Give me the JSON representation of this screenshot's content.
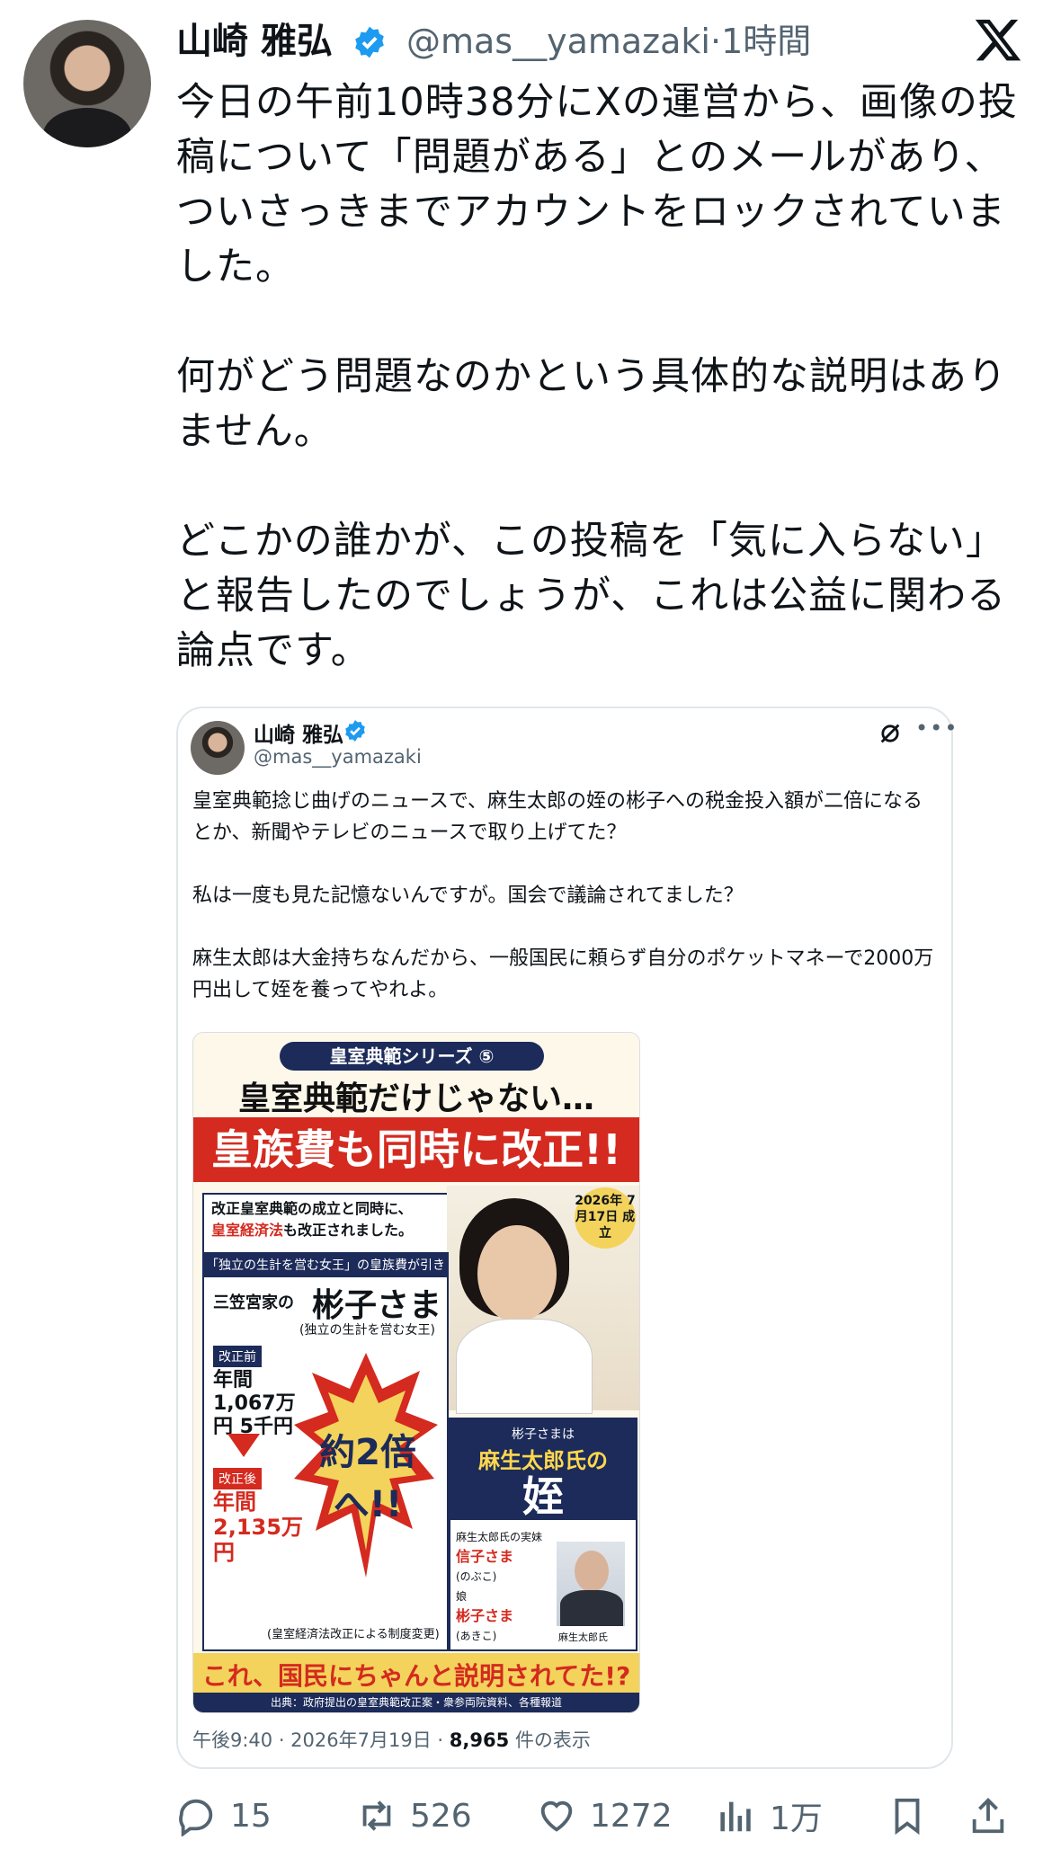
{
  "author": {
    "name": "山崎 雅弘",
    "handle": "@mas__yamazaki",
    "time": "·1時間"
  },
  "tweet": {
    "paragraphs": [
      "今日の午前10時38分にXの運営から、画像の投稿について「問題がある」とのメールがあり、ついさっきまでアカウントをロックされていました。",
      "何がどう問題なのかという具体的な説明はありません。",
      "どこかの誰かが、この投稿を「気に入らない」と報告したのでしょうが、これは公益に関わる論点です。"
    ]
  },
  "quote": {
    "name": "山崎 雅弘",
    "handle": "@mas__yamazaki",
    "paragraphs": [
      "皇室典範捻じ曲げのニュースで、麻生太郎の姪の彬子への税金投入額が二倍になるとか、新聞やテレビのニュースで取り上げてた？",
      "私は一度も見た記憶ないんですが。国会で議論されてました？",
      "麻生太郎は大金持ちなんだから、一般国民に頼らず自分のポケットマネーで2000万円出して姪を養ってやれよ。"
    ],
    "time": "午後9:40 · 2026年7月19日 · ",
    "views": "8,965",
    "views_label": " 件の表示"
  },
  "poster": {
    "series": "皇室典範シリーズ ⑤",
    "head1": "皇室典範だけじゃない…",
    "head2": "皇族費も同時に改正!!",
    "box1_line1": "改正皇室典範の成立と同時に、",
    "box1_red": "皇室経済法",
    "box1_line2": "も改正されました。",
    "date": "2026年 7月17日 成立",
    "left_head": "「独立の生計を営む女王」の皇族費が引き上げに",
    "mikasa": "三笠宮家の",
    "akiko": "彬子さま",
    "akiko_sub": "(独立の生計を営む女王)",
    "before_label": "改正前",
    "before_value": "年間 1,067万円 5千円",
    "after_label": "改正後",
    "after_value": "年間 2,135万円",
    "burst": "約2倍へ!!",
    "left_foot": "(皇室経済法改正による制度変更)",
    "niece_small": "彬子さまは",
    "niece_mid": "麻生太郎氏の",
    "niece_big": "姪",
    "family_1": "麻生太郎氏の実妹",
    "family_2": "信子さま",
    "family_3": "(のぶこ)",
    "family_4": "娘",
    "family_5": "彬子さま",
    "family_6": "(あきこ)",
    "aso_label": "麻生太郎氏",
    "bottom": "これ、国民にちゃんと説明されてた!?",
    "source": "出典：政府提出の皇室典範改正案・衆参両院資料、各種報道"
  },
  "actions": {
    "replies": "15",
    "reposts": "526",
    "likes": "1272",
    "views": "1万"
  },
  "colors": {
    "verified": "#1d9bf0",
    "muted": "#536471",
    "poster_red": "#d42a1f",
    "poster_navy": "#1c2b5a"
  }
}
